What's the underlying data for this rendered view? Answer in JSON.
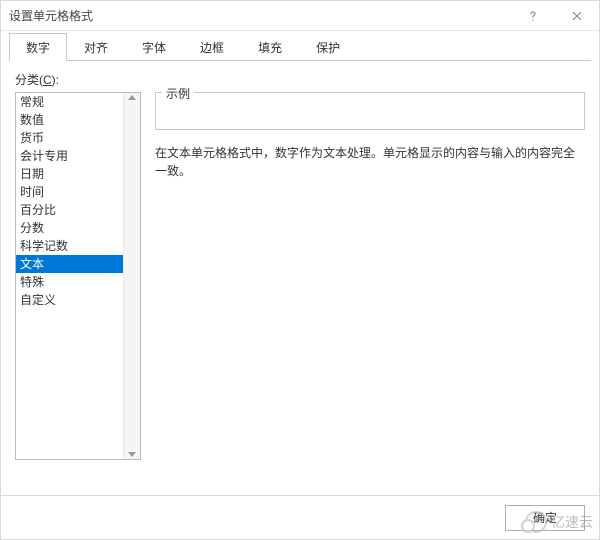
{
  "window": {
    "title": "设置单元格格式",
    "help_icon": "help-icon",
    "close_icon": "close-icon"
  },
  "tabs": [
    {
      "label": "数字",
      "active": true
    },
    {
      "label": "对齐",
      "active": false
    },
    {
      "label": "字体",
      "active": false
    },
    {
      "label": "边框",
      "active": false
    },
    {
      "label": "填充",
      "active": false
    },
    {
      "label": "保护",
      "active": false
    }
  ],
  "category": {
    "label_prefix": "分类(",
    "label_hotkey": "C",
    "label_suffix": "):",
    "items": [
      "常规",
      "数值",
      "货币",
      "会计专用",
      "日期",
      "时间",
      "百分比",
      "分数",
      "科学记数",
      "文本",
      "特殊",
      "自定义"
    ],
    "selected_index": 9
  },
  "sample": {
    "group_label": "示例",
    "value": ""
  },
  "description": "在文本单元格格式中，数字作为文本处理。单元格显示的内容与输入的内容完全一致。",
  "buttons": {
    "ok": "确定"
  },
  "watermark": "亿速云",
  "colors": {
    "selection": "#0078d7",
    "border": "#c9c9c7"
  }
}
